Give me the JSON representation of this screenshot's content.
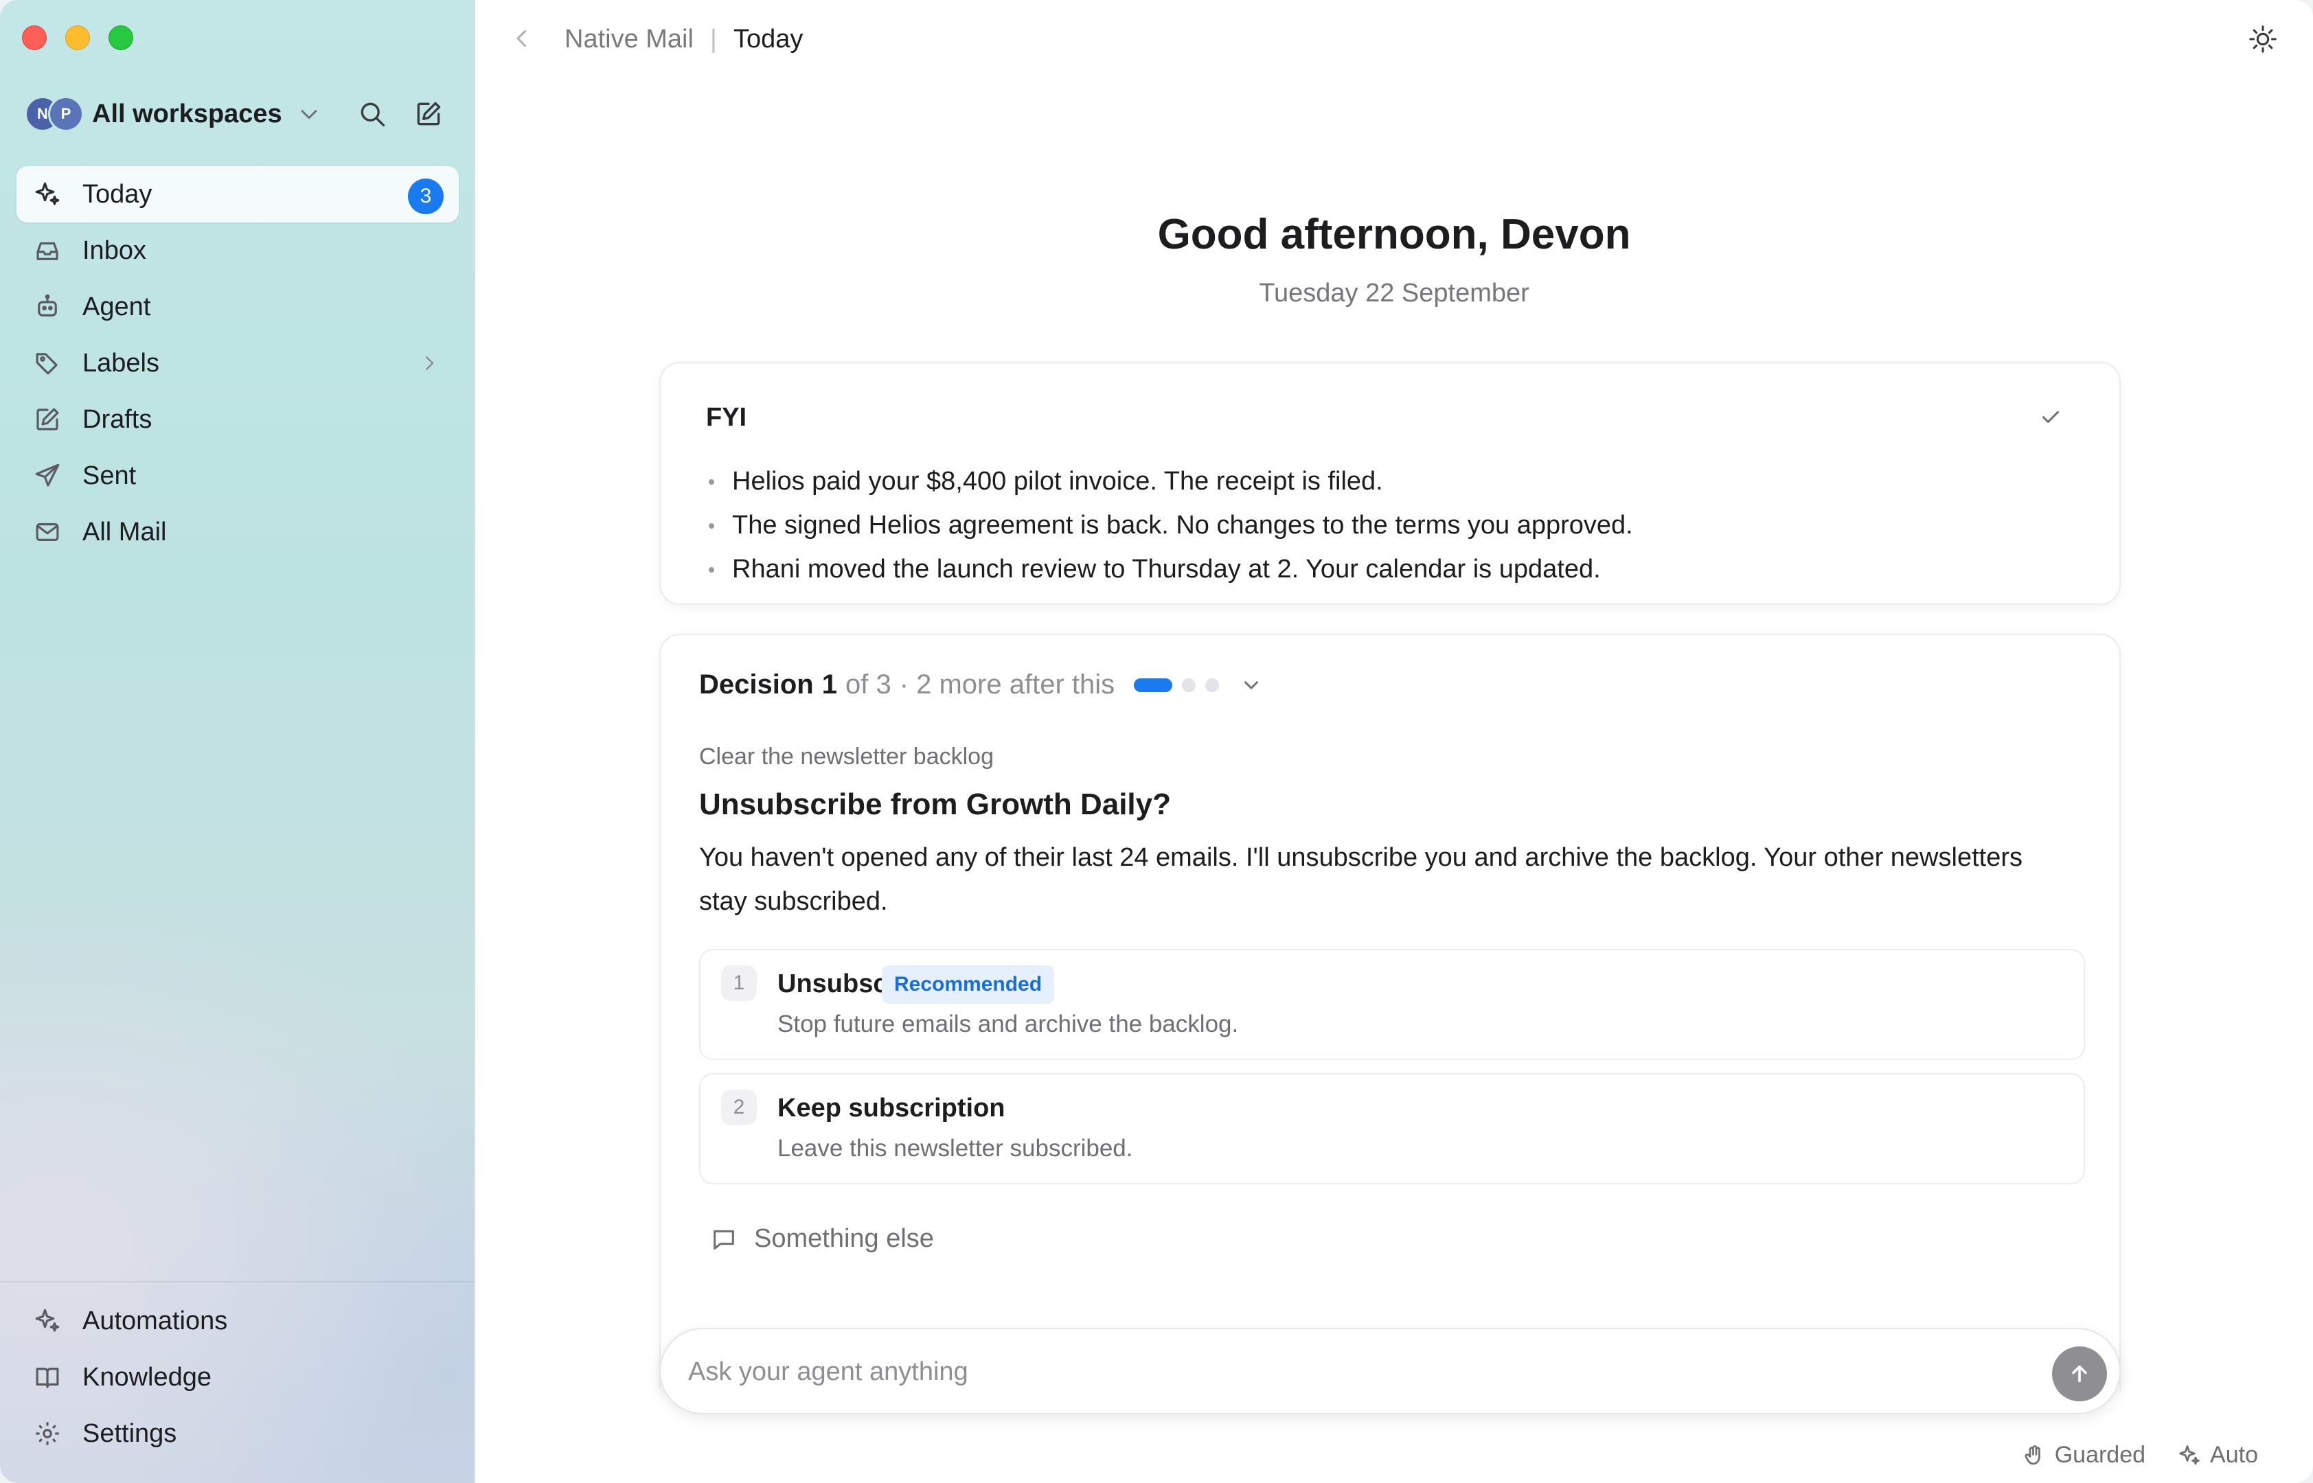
{
  "sidebar": {
    "workspace": {
      "avatars": [
        "N",
        "P"
      ],
      "name": "All workspaces"
    },
    "items": [
      {
        "label": "Today",
        "icon": "sparkles-icon",
        "badge": "3",
        "active": true
      },
      {
        "label": "Inbox",
        "icon": "inbox-icon"
      },
      {
        "label": "Agent",
        "icon": "robot-icon"
      },
      {
        "label": "Labels",
        "icon": "tag-icon",
        "has_submenu": true
      },
      {
        "label": "Drafts",
        "icon": "edit-icon"
      },
      {
        "label": "Sent",
        "icon": "send-icon"
      },
      {
        "label": "All Mail",
        "icon": "mail-icon"
      }
    ],
    "bottom_items": [
      {
        "label": "Automations",
        "icon": "sparkles-icon"
      },
      {
        "label": "Knowledge",
        "icon": "book-icon"
      },
      {
        "label": "Settings",
        "icon": "gear-icon"
      }
    ]
  },
  "header": {
    "app_name": "Native Mail",
    "separator": "|",
    "page": "Today"
  },
  "main": {
    "greeting": "Good afternoon, Devon",
    "date": "Tuesday 22 September",
    "fyi": {
      "title": "FYI",
      "items": [
        "Helios paid your $8,400 pilot invoice. The receipt is filed.",
        "The signed Helios agreement is back. No changes to the terms you approved.",
        "Rhani moved the launch review to Thursday at 2. Your calendar is updated."
      ]
    },
    "decision": {
      "label": "Decision",
      "current": "1",
      "of_text": "of 3",
      "remaining_text": "· 2 more after this",
      "progress": {
        "current": 1,
        "total": 3
      },
      "context": "Clear the newsletter backlog",
      "question": "Unsubscribe from Growth Daily?",
      "body": "You haven't opened any of their last 24 emails. I'll unsubscribe you and archive the backlog. Your other newsletters stay subscribed.",
      "options": [
        {
          "number": "1",
          "title": "Unsubscribe",
          "badge": "Recommended",
          "description": "Stop future emails and archive the backlog."
        },
        {
          "number": "2",
          "title": "Keep subscription",
          "description": "Leave this newsletter subscribed."
        }
      ],
      "something_else": "Something else"
    },
    "ask": {
      "placeholder": "Ask your agent anything",
      "value": ""
    }
  },
  "status_bar": {
    "guarded": "Guarded",
    "auto": "Auto"
  },
  "colors": {
    "accent": "#1a7af0",
    "badge_bg": "#e6f0fd",
    "badge_text": "#1a6fd6"
  }
}
